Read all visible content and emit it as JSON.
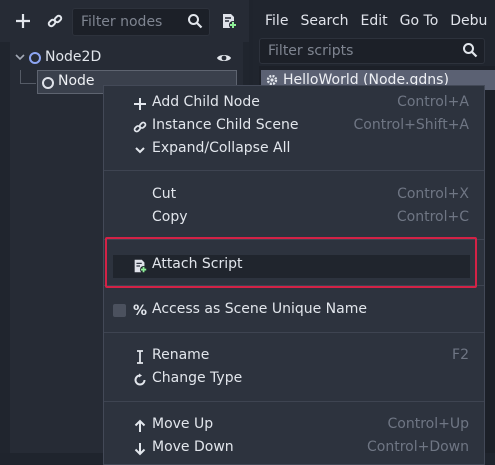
{
  "scene_dock": {
    "toolbar": {
      "add_icon": "plus-icon",
      "link_icon": "link-icon",
      "filter_placeholder": "Filter nodes",
      "search_icon": "search-icon",
      "script_icon": "attach-script-icon"
    },
    "tree": [
      {
        "label": "Node2D",
        "icon": "node2d-icon",
        "visible_icon": "eye-icon"
      },
      {
        "label": "Node",
        "icon": "node-icon"
      }
    ]
  },
  "script_editor": {
    "menu": [
      "File",
      "Search",
      "Edit",
      "Go To",
      "Debu"
    ],
    "filter_placeholder": "Filter scripts",
    "scripts": [
      {
        "label": "HelloWorld (Node.gdns)",
        "icon": "gear-icon"
      }
    ]
  },
  "context_menu": {
    "items": [
      {
        "label": "Add Child Node",
        "shortcut": "Control+A",
        "icon": "plus-icon"
      },
      {
        "label": "Instance Child Scene",
        "shortcut": "Control+Shift+A",
        "icon": "link-icon"
      },
      {
        "label": "Expand/Collapse All",
        "shortcut": "",
        "icon": "chevron-down-icon"
      },
      {
        "label": "Cut",
        "shortcut": "Control+X",
        "icon": ""
      },
      {
        "label": "Copy",
        "shortcut": "Control+C",
        "icon": ""
      },
      {
        "label": "Attach Script",
        "shortcut": "",
        "icon": "attach-script-icon"
      },
      {
        "label": "Access as Scene Unique Name",
        "shortcut": "",
        "icon": "percent-icon",
        "checked": false
      },
      {
        "label": "Rename",
        "shortcut": "F2",
        "icon": "rename-icon"
      },
      {
        "label": "Change Type",
        "shortcut": "",
        "icon": "change-type-icon"
      },
      {
        "label": "Move Up",
        "shortcut": "Control+Up",
        "icon": "arrow-up-icon"
      },
      {
        "label": "Move Down",
        "shortcut": "Control+Down",
        "icon": "arrow-down-icon"
      }
    ]
  },
  "colors": {
    "highlight_border": "#d32246",
    "node2d_accent": "#8da5f3",
    "script_accent": "#8eef97"
  }
}
